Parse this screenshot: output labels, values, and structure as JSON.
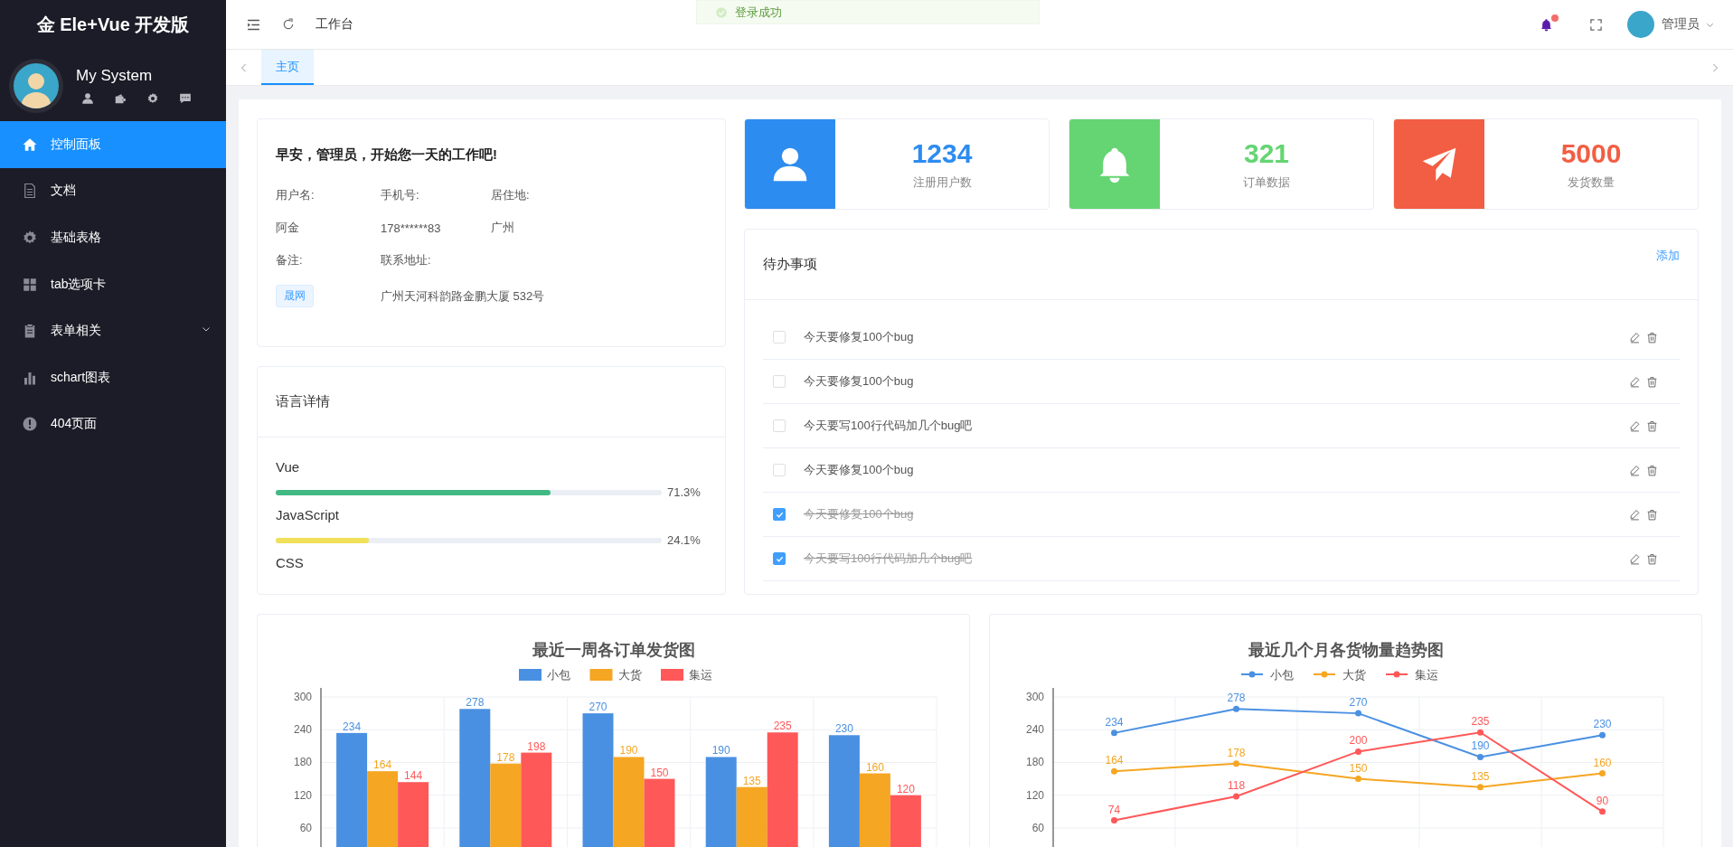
{
  "sidebar": {
    "logo": "金 Ele+Vue 开发版",
    "profile": {
      "name": "My System"
    },
    "menu": [
      {
        "label": "控制面板",
        "kind": "home",
        "selected": true,
        "submenu": false
      },
      {
        "label": "文档",
        "kind": "document",
        "selected": false,
        "submenu": false
      },
      {
        "label": "基础表格",
        "kind": "gear",
        "selected": false,
        "submenu": false
      },
      {
        "label": "tab选项卡",
        "kind": "grid",
        "selected": false,
        "submenu": false
      },
      {
        "label": "表单相关",
        "kind": "clipboard",
        "selected": false,
        "submenu": true
      },
      {
        "label": "schart图表",
        "kind": "chart",
        "selected": false,
        "submenu": false
      },
      {
        "label": "404页面",
        "kind": "warning",
        "selected": false,
        "submenu": false
      }
    ]
  },
  "header": {
    "breadcrumb": "工作台",
    "toast": "登录成功",
    "notifications": {
      "unread": true
    },
    "user": "管理员"
  },
  "tabs": [
    {
      "label": "主页",
      "selected": true
    }
  ],
  "user_card": {
    "greeting": "早安，管理员，开始您一天的工作吧!",
    "rows": [
      [
        {
          "label": "用户名:",
          "value": "阿金",
          "kind": "text"
        },
        {
          "label": "手机号:",
          "value": "178******83",
          "kind": "text"
        },
        {
          "label": "居住地:",
          "value": "广州",
          "kind": "text"
        }
      ],
      [
        {
          "label": "备注:",
          "value": "晟网",
          "kind": "tag"
        },
        {
          "label": "联系地址:",
          "value": "广州天河科韵路金鹏大厦 532号",
          "kind": "text"
        }
      ]
    ]
  },
  "languages": {
    "title": "语言详情",
    "items": [
      {
        "name": "Vue",
        "level": 0.713,
        "reading": "71.3%",
        "color": "#42b983"
      },
      {
        "name": "JavaScript",
        "level": 0.241,
        "reading": "24.1%",
        "color": "#f1e05a"
      },
      {
        "name": "CSS"
      }
    ]
  },
  "stats": [
    {
      "value": "1234",
      "label": "注册用户数",
      "color": "#2d8cf0",
      "kind": "user"
    },
    {
      "value": "321",
      "label": "订单数据",
      "color": "#64d572",
      "kind": "bell"
    },
    {
      "value": "5000",
      "label": "发货数量",
      "color": "#f25e43",
      "kind": "plane"
    }
  ],
  "todos": {
    "title": "待办事项",
    "add": "添加",
    "items": [
      {
        "text": "今天要修复100个bug",
        "checked": false
      },
      {
        "text": "今天要修复100个bug",
        "checked": false
      },
      {
        "text": "今天要写100行代码加几个bug吧",
        "checked": false
      },
      {
        "text": "今天要修复100个bug",
        "checked": false
      },
      {
        "text": "今天要修复100个bug",
        "checked": true
      },
      {
        "text": "今天要写100行代码加几个bug吧",
        "checked": true
      }
    ]
  },
  "charts": [
    {
      "chart_data": {
        "type": "bar",
        "title": "最近一周各订单发货图",
        "ylim": [
          23.5,
          300
        ],
        "yticks": [
          60,
          120,
          180,
          240,
          300
        ],
        "grid": true,
        "legend": true,
        "data_labels": true,
        "series": [
          {
            "name": "小包",
            "color": "#4a90e2",
            "values": [
              234,
              278,
              270,
              190,
              230
            ]
          },
          {
            "name": "大货",
            "color": "#f5a623",
            "values": [
              164,
              178,
              190,
              135,
              160
            ]
          },
          {
            "name": "集运",
            "color": "#ff5858",
            "values": [
              144,
              198,
              150,
              235,
              120
            ]
          }
        ]
      }
    },
    {
      "chart_data": {
        "type": "line",
        "title": "最近几个月各货物量趋势图",
        "ylim": [
          23.5,
          300
        ],
        "yticks": [
          60,
          120,
          180,
          240,
          300
        ],
        "grid": true,
        "legend": true,
        "data_labels": true,
        "series": [
          {
            "name": "小包",
            "color": "#4a90e2",
            "marker": "circle",
            "values": [
              234,
              278,
              270,
              190,
              230
            ]
          },
          {
            "name": "大货",
            "color": "#f5a623",
            "marker": "circle",
            "values": [
              164,
              178,
              150,
              135,
              160
            ]
          },
          {
            "name": "集运",
            "color": "#ff5858",
            "marker": "circle",
            "values": [
              74,
              118,
              200,
              235,
              90
            ]
          }
        ]
      }
    }
  ]
}
